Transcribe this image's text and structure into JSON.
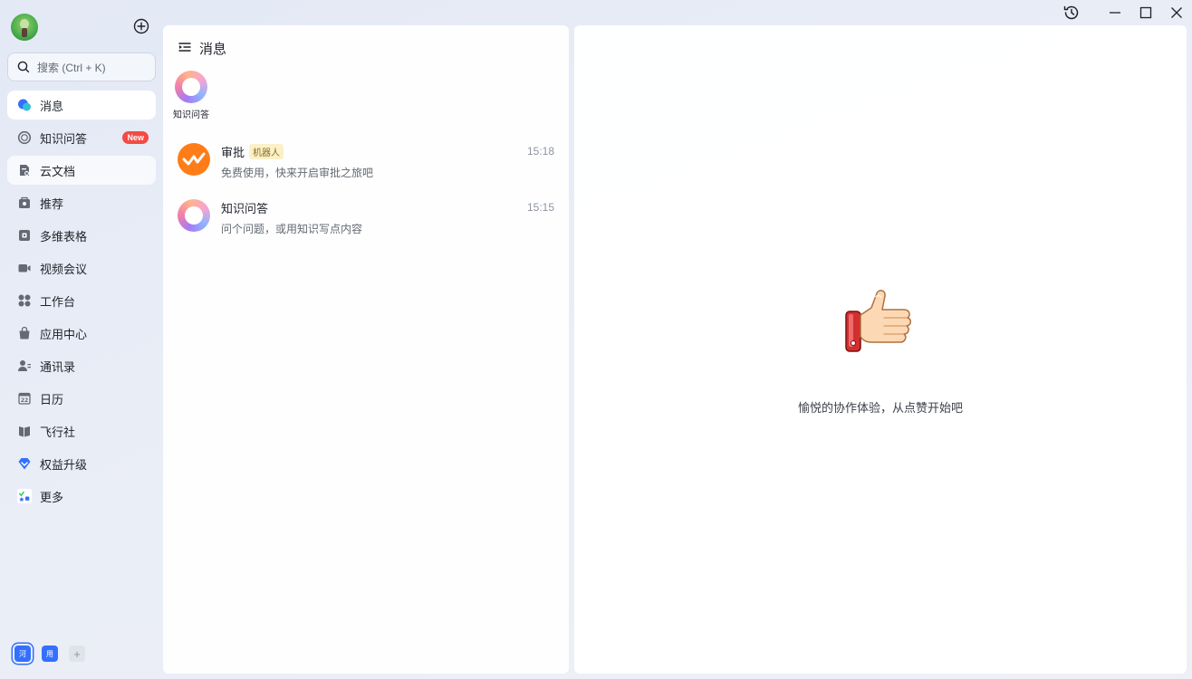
{
  "sidebar": {
    "search_placeholder": "搜索 (Ctrl + K)",
    "items": [
      {
        "label": "消息",
        "icon": "chat-bubble-icon"
      },
      {
        "label": "知识问答",
        "icon": "knowledge-qa-icon",
        "badge": "New"
      },
      {
        "label": "云文档",
        "icon": "cloud-doc-icon"
      },
      {
        "label": "推荐",
        "icon": "recommend-icon"
      },
      {
        "label": "多维表格",
        "icon": "base-table-icon"
      },
      {
        "label": "视频会议",
        "icon": "video-meeting-icon"
      },
      {
        "label": "工作台",
        "icon": "workplace-icon"
      },
      {
        "label": "应用中心",
        "icon": "app-center-icon"
      },
      {
        "label": "通讯录",
        "icon": "contacts-icon"
      },
      {
        "label": "日历",
        "icon": "calendar-icon"
      },
      {
        "label": "飞行社",
        "icon": "community-icon"
      },
      {
        "label": "权益升级",
        "icon": "upgrade-diamond-icon"
      },
      {
        "label": "更多",
        "icon": "more-apps-icon"
      }
    ],
    "calendar_icon_day": "22",
    "workspaces": [
      {
        "label": "河",
        "selected": true
      },
      {
        "label": "用",
        "selected": false
      }
    ],
    "workspace_add": "+"
  },
  "messages_panel": {
    "title": "消息",
    "pinned": {
      "label": "知识问答"
    },
    "chats": [
      {
        "name": "审批",
        "tag": "机器人",
        "time": "15:18",
        "preview": "免费使用，快来开启审批之旅吧"
      },
      {
        "name": "知识问答",
        "tag": "",
        "time": "15:15",
        "preview": "问个问题，或用知识写点内容"
      }
    ]
  },
  "main_panel": {
    "empty_text": "愉悦的协作体验，从点赞开始吧"
  },
  "colors": {
    "accent": "#3370ff",
    "badge_red": "#f54a45",
    "approval_orange": "#ff7d18"
  }
}
